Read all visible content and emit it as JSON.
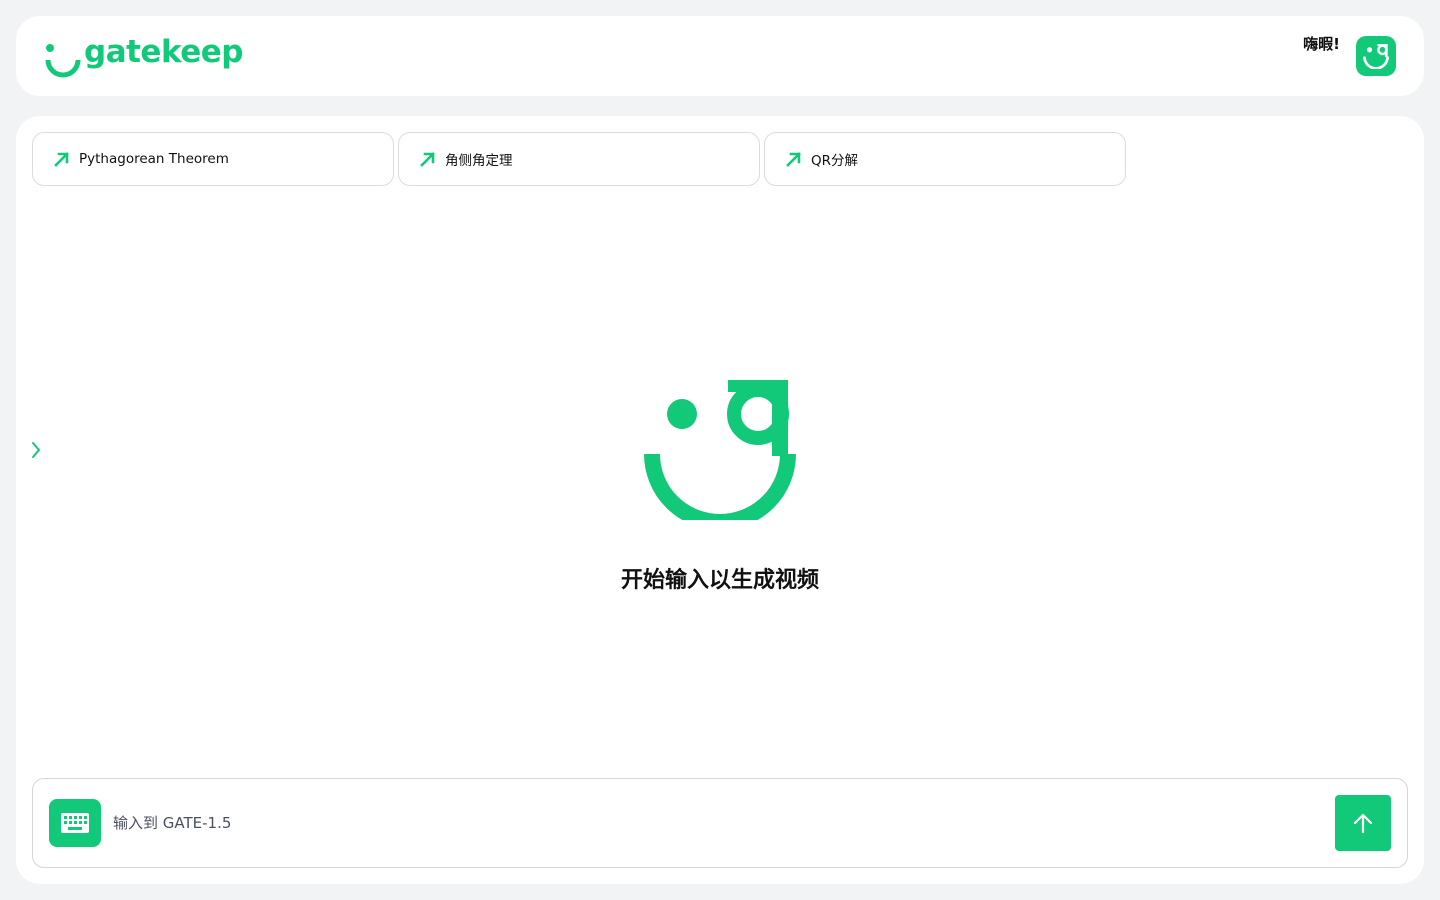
{
  "brand": {
    "name": "gatekeep",
    "accent_color": "#12c97a"
  },
  "header": {
    "greeting": "嗨暇!",
    "avatar_icon": "gatekeep-logo-icon"
  },
  "suggestions": [
    {
      "label": "Pythagorean Theorem",
      "icon": "arrow-up-right-icon"
    },
    {
      "label": "角侧角定理",
      "icon": "arrow-up-right-icon"
    },
    {
      "label": "QR分解",
      "icon": "arrow-up-right-icon"
    }
  ],
  "empty_state": {
    "title": "开始输入以生成视频"
  },
  "composer": {
    "placeholder": "输入到 GATE-1.5",
    "value": "",
    "keyboard_icon": "keyboard-icon",
    "send_icon": "arrow-up-icon"
  },
  "sidebar_toggle_icon": "chevron-right-icon"
}
